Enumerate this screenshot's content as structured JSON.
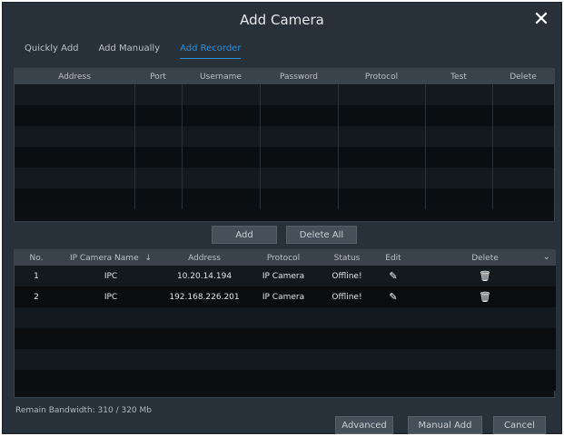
{
  "window": {
    "title": "Add Camera"
  },
  "tabs": [
    {
      "label": "Quickly Add"
    },
    {
      "label": "Add Manually"
    },
    {
      "label": "Add Recorder"
    }
  ],
  "recorder_table": {
    "columns": [
      "Address",
      "Port",
      "Username",
      "Password",
      "Protocol",
      "Test",
      "Delete"
    ],
    "empty_rows": 6
  },
  "recorder_actions": {
    "add_label": "Add",
    "delete_all_label": "Delete All"
  },
  "camera_table": {
    "columns": [
      "No.",
      "IP Camera Name",
      "Address",
      "Protocol",
      "Status",
      "Edit",
      "Delete"
    ],
    "sort_indicator": "↓",
    "rows": [
      {
        "no": "1",
        "name": "IPC",
        "address": "10.20.14.194",
        "protocol": "IP Camera",
        "status": "Offline!"
      },
      {
        "no": "2",
        "name": "IPC",
        "address": "192.168.226.201",
        "protocol": "IP Camera",
        "status": "Offline!"
      }
    ]
  },
  "footer": {
    "bandwidth_label": "Remain Bandwidth: 310 / 320 Mb",
    "advanced_label": "Advanced",
    "manual_add_label": "Manual Add",
    "cancel_label": "Cancel"
  },
  "colors": {
    "accent": "#2f8fd6",
    "dialog_bg": "#28313a",
    "panel_bg": "#0c1013"
  },
  "icons": {
    "close": "close-icon",
    "edit": "pencil-icon",
    "delete": "trash-icon",
    "sort": "arrow-down-icon",
    "dropdown": "chevron-down-icon"
  }
}
